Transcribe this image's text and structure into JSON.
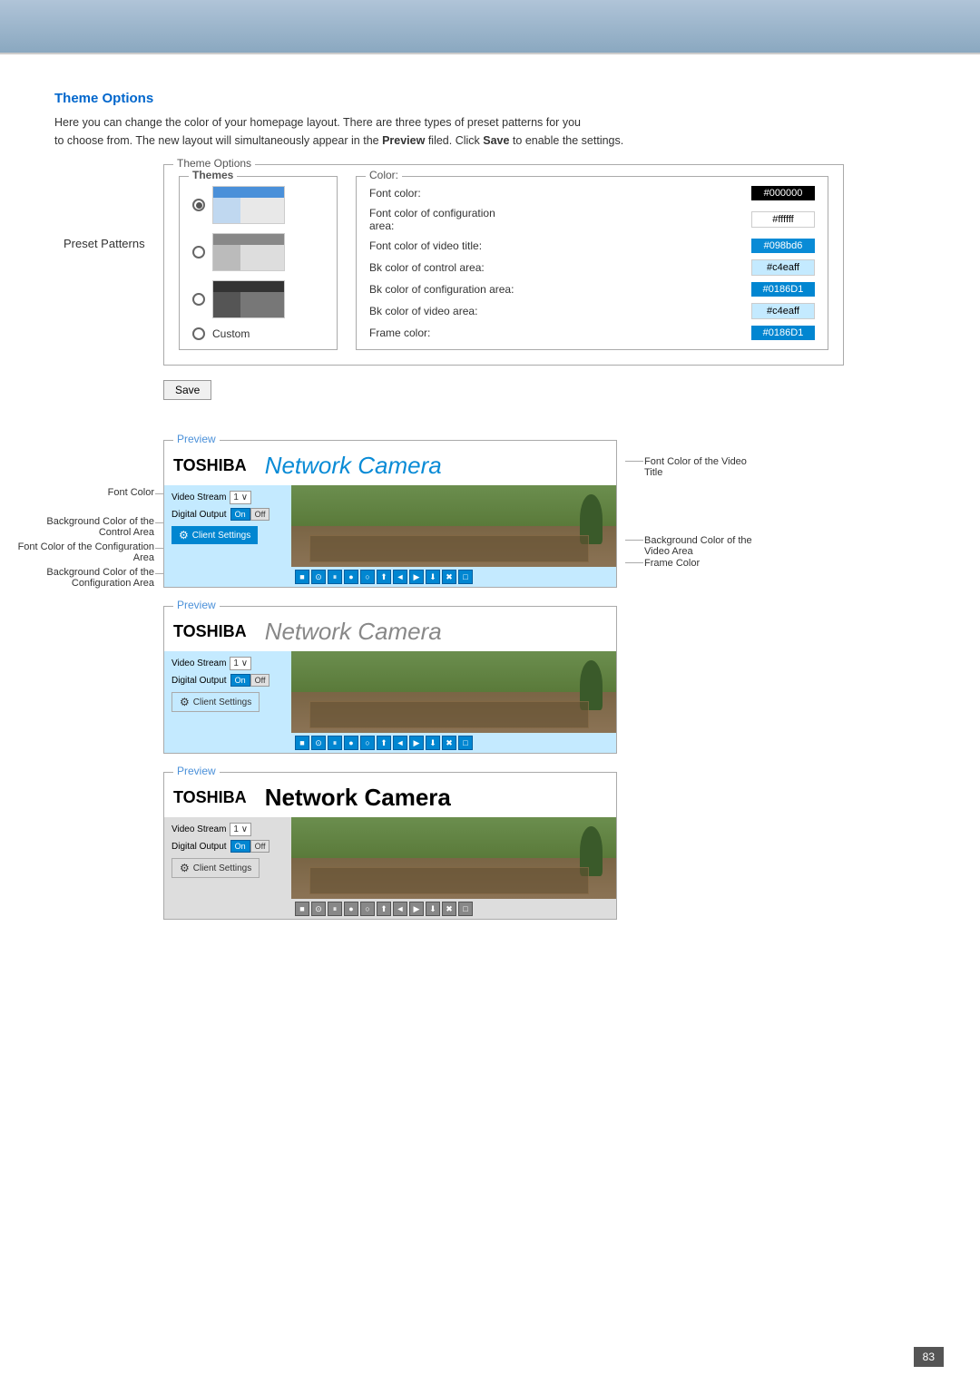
{
  "page": {
    "title": "Theme Options",
    "description_1": "Here you can change the color of your homepage layout. There are three types of preset patterns for you",
    "description_2": "to choose from. The new layout will simultaneously appear in the ",
    "description_bold_1": "Preview",
    "description_3": " filed. Click ",
    "description_bold_2": "Save",
    "description_4": " to enable the settings."
  },
  "panel": {
    "title": "Theme Options",
    "themes_title": "Themes",
    "color_title": "Color:",
    "preset_label": "Preset Patterns"
  },
  "themes": [
    {
      "id": 1,
      "selected": true
    },
    {
      "id": 2,
      "selected": false
    },
    {
      "id": 3,
      "selected": false
    },
    {
      "id": 4,
      "selected": false,
      "label": "Custom"
    }
  ],
  "colors": [
    {
      "label": "Font color:",
      "value": "#000000",
      "bg": "#000000",
      "text": "#ffffff"
    },
    {
      "label": "Font color of configuration area:",
      "value": "#ffffff",
      "bg": "#ffffff",
      "text": "#000000",
      "border": "1px solid #ccc"
    },
    {
      "label": "Font color of video title:",
      "value": "#098bd6",
      "bg": "#098bd6",
      "text": "#ffffff"
    },
    {
      "label": "Bk color of control area:",
      "value": "#c4eaff",
      "bg": "#c4eaff",
      "text": "#000000",
      "border": "1px solid #ccc"
    },
    {
      "label": "Bk color of configuration area:",
      "value": "#0186D1",
      "bg": "#0186D1",
      "text": "#ffffff"
    },
    {
      "label": "Bk color of video area:",
      "value": "#c4eaff",
      "bg": "#c4eaff",
      "text": "#000000",
      "border": "1px solid #ccc"
    },
    {
      "label": "Frame color:",
      "value": "#0186D1",
      "bg": "#0186D1",
      "text": "#ffffff"
    }
  ],
  "buttons": {
    "save": "Save"
  },
  "previews": [
    {
      "title": "Preview",
      "theme": "blue",
      "logo": "TOSHIBA",
      "camera_title": "Network Camera",
      "video_stream_label": "Video Stream",
      "video_stream_value": "1",
      "digital_output_label": "Digital Output",
      "on_label": "On",
      "off_label": "Off",
      "client_settings": "Client Settings"
    },
    {
      "title": "Preview",
      "theme": "gray",
      "logo": "TOSHIBA",
      "camera_title": "Network Camera",
      "video_stream_label": "Video Stream",
      "video_stream_value": "1",
      "digital_output_label": "Digital Output",
      "on_label": "On",
      "off_label": "Off",
      "client_settings": "Client Settings"
    },
    {
      "title": "Preview",
      "theme": "dark",
      "logo": "TOSHIBA",
      "camera_title": "Network Camera",
      "video_stream_label": "Video Stream",
      "video_stream_value": "1",
      "digital_output_label": "Digital Output",
      "on_label": "On",
      "off_label": "Off",
      "client_settings": "Client Settings"
    }
  ],
  "annotations": {
    "left": {
      "font_color": "Font Color",
      "bg_control": "Background Color of the\nControl Area",
      "font_config": "Font Color of the Configuration Area",
      "bg_config": "Background Color of the\nConfiguration Area"
    },
    "right": {
      "font_video_title": "Font Color of the Video\nTitle",
      "bg_video": "Background Color of the\nVideo Area",
      "frame_color": "Frame Color"
    }
  },
  "page_number": "83"
}
